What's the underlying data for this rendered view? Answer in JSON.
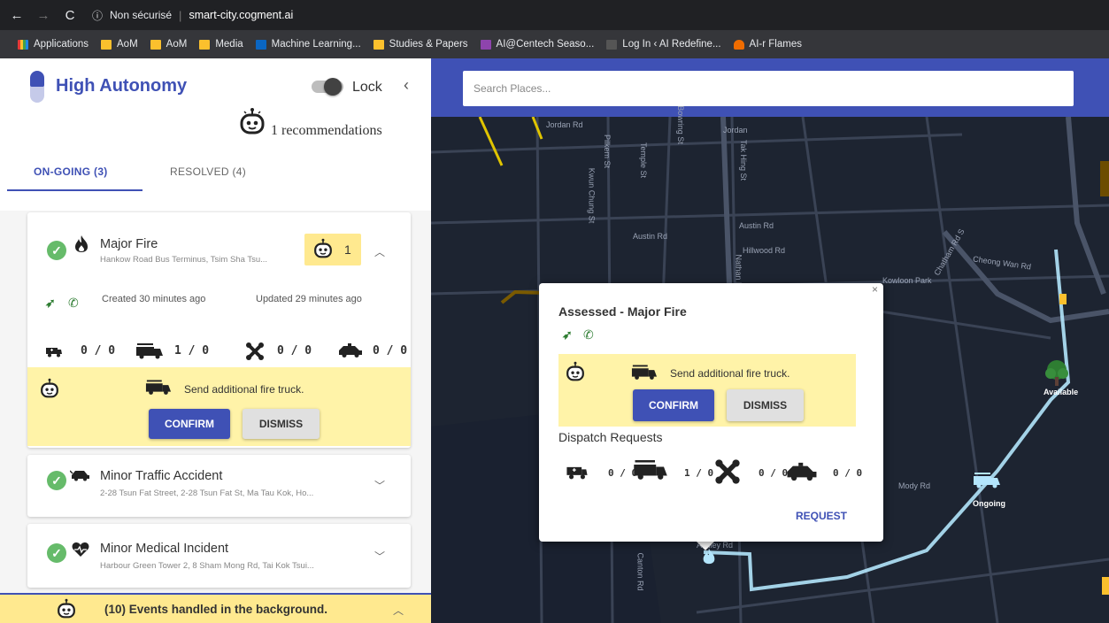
{
  "browser": {
    "security": "Non sécurisé",
    "url": "smart-city.cogment.ai",
    "bookmarks": [
      "Applications",
      "AoM",
      "AoM",
      "Media",
      "Machine Learning...",
      "Studies & Papers",
      "AI@Centech Seaso...",
      "Log In ‹ AI Redefine...",
      "AI-r Flames"
    ]
  },
  "sidebar": {
    "title": "High Autonomy",
    "lock_label": "Lock",
    "lock_on": true,
    "recommendations": "1 recommendations",
    "tabs": {
      "ongoing": "ON-GOING (3)",
      "resolved": "RESOLVED (4)"
    },
    "events": [
      {
        "title": "Major Fire",
        "address": "Hankow Road Bus Terminus, Tsim Sha Tsu...",
        "reco_count": "1",
        "created": "Created 30 minutes ago",
        "updated": "Updated 29 minutes ago",
        "counts": [
          "0 / 0",
          "1 / 0",
          "0 / 0",
          "0 / 0"
        ],
        "recommendation": "Send additional fire truck.",
        "confirm": "CONFIRM",
        "dismiss": "DISMISS"
      },
      {
        "title": "Minor Traffic Accident",
        "address": "2-28 Tsun Fat Street, 2-28 Tsun Fat St, Ma Tau Kok, Ho..."
      },
      {
        "title": "Minor Medical Incident",
        "address": "Harbour Green Tower 2, 8 Sham Mong Rd, Tai Kok Tsui..."
      }
    ],
    "background_events": "(10) Events handled in the background."
  },
  "map": {
    "search_placeholder": "Search Places...",
    "street_labels": [
      "Jordan Rd",
      "Jordan",
      "Austin Rd",
      "Austin Rd",
      "Hillwood Rd",
      "Nathan Rd",
      "Cheong Wan Rd",
      "Chatham Rd S",
      "Kowloon Park",
      "Mody Rd",
      "Canton Rd",
      "Pilkem St",
      "Temple St",
      "Tak Hing St",
      "Kwun Chung St",
      "Ashley Rd",
      "Bowring St"
    ],
    "markers": {
      "available": "Available",
      "ongoing": "Ongoing"
    },
    "popup": {
      "title": "Assessed - Major Fire",
      "recommendation": "Send additional fire truck.",
      "confirm": "CONFIRM",
      "dismiss": "DISMISS",
      "dispatch_title": "Dispatch Requests",
      "counts": [
        "0 / 0",
        "1 / 0",
        "0 / 0",
        "0 / 0"
      ],
      "request": "REQUEST"
    }
  },
  "colors": {
    "primary": "#3f51b5",
    "reco_yellow": "#fff3a8",
    "success": "#66bb6a",
    "map_bg": "#1d2431",
    "route": "#b3e5fc"
  }
}
